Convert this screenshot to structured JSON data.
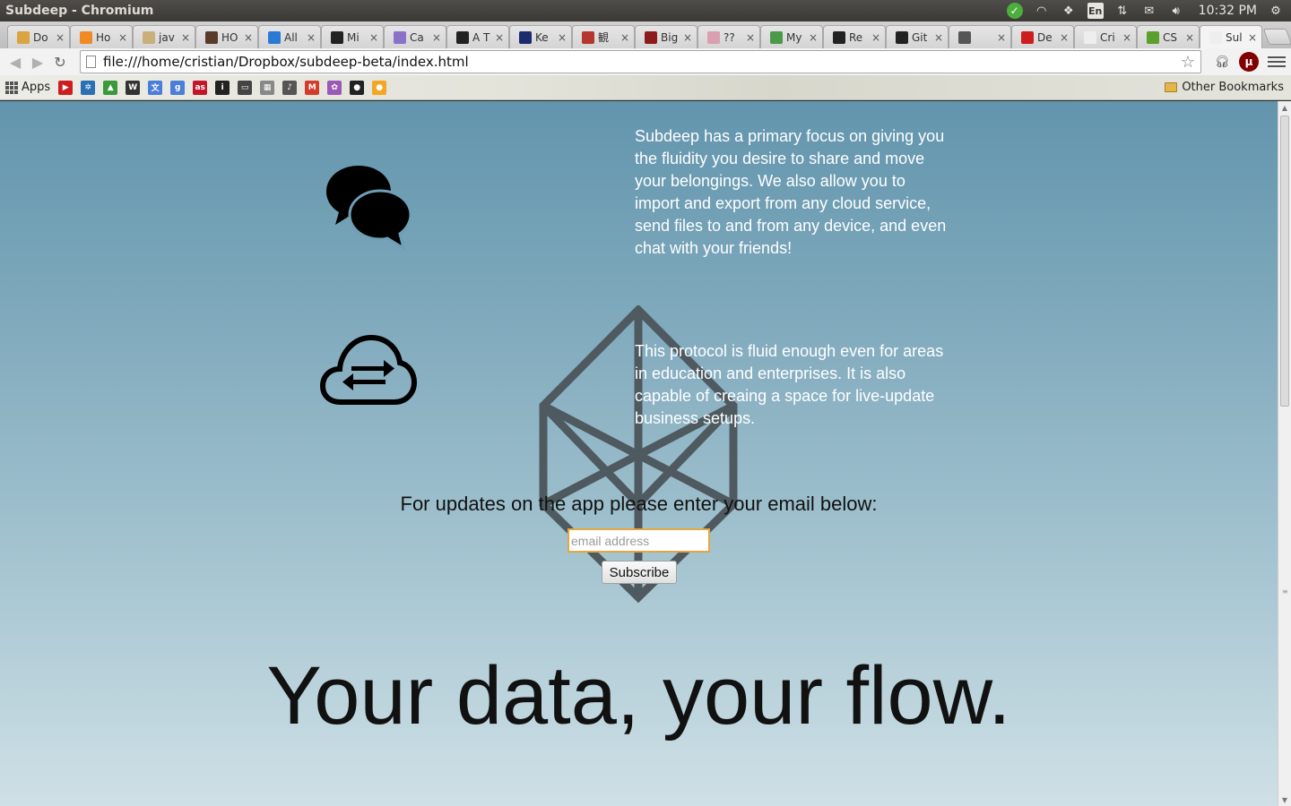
{
  "os": {
    "window_title": "Subdeep - Chromium",
    "keyboard": "En",
    "clock": "10:32 PM"
  },
  "tabs": [
    {
      "label": "Do",
      "favicon_color": "#d9a441",
      "icon": "generic-favicon"
    },
    {
      "label": "Ho",
      "favicon_color": "#f08a24",
      "icon": "asterisk-favicon"
    },
    {
      "label": "jav",
      "favicon_color": "#c9b07a",
      "icon": "generic-favicon"
    },
    {
      "label": "HO",
      "favicon_color": "#5a3a2a",
      "icon": "generic-favicon"
    },
    {
      "label": "All",
      "favicon_color": "#2a7ad5",
      "icon": "plus-favicon"
    },
    {
      "label": "Mi",
      "favicon_color": "#222222",
      "icon": "he-favicon"
    },
    {
      "label": "Ca",
      "favicon_color": "#8a72c9",
      "icon": "m-favicon"
    },
    {
      "label": "A T",
      "favicon_color": "#222222",
      "icon": "he-favicon"
    },
    {
      "label": "Ke",
      "favicon_color": "#1c2a6e",
      "icon": "film-favicon"
    },
    {
      "label": "観",
      "favicon_color": "#b5362d",
      "icon": "generic-favicon"
    },
    {
      "label": "Big",
      "favicon_color": "#8c1c1c",
      "icon": "generic-favicon"
    },
    {
      "label": "??",
      "favicon_color": "#d8a0b0",
      "icon": "generic-favicon"
    },
    {
      "label": "My",
      "favicon_color": "#4a9a4a",
      "icon": "drive-favicon"
    },
    {
      "label": "Re",
      "favicon_color": "#222222",
      "icon": "github-favicon"
    },
    {
      "label": "Git",
      "favicon_color": "#222222",
      "icon": "github-favicon"
    },
    {
      "label": "",
      "favicon_color": "#555555",
      "icon": "image-favicon"
    },
    {
      "label": "De",
      "favicon_color": "#cc1e1e",
      "icon": "youtube-favicon"
    },
    {
      "label": "Cri",
      "favicon_color": "#eeeeee",
      "icon": "page-favicon"
    },
    {
      "label": "CS",
      "favicon_color": "#5aa02c",
      "icon": "generic-favicon"
    },
    {
      "label": "Sul",
      "favicon_color": "#eeeeee",
      "icon": "page-favicon",
      "active": true
    }
  ],
  "toolbar": {
    "url": "file:///home/cristian/Dropbox/subdeep-beta/index.html"
  },
  "bookmarks": {
    "apps_label": "Apps",
    "items": [
      {
        "icon": "youtube-icon",
        "color": "#cc1e1e",
        "glyph": "▶"
      },
      {
        "icon": "network-icon",
        "color": "#2b6fb5",
        "glyph": "✲"
      },
      {
        "icon": "drive-icon",
        "color": "#3a9a3a",
        "glyph": "▲"
      },
      {
        "icon": "wikipedia-icon",
        "color": "#333333",
        "glyph": "W"
      },
      {
        "icon": "translate-icon",
        "color": "#4a7ed8",
        "glyph": "文"
      },
      {
        "icon": "google-icon",
        "color": "#4a7ed8",
        "glyph": "g"
      },
      {
        "icon": "lastfm-icon",
        "color": "#c4162a",
        "glyph": "as"
      },
      {
        "icon": "instapaper-icon",
        "color": "#222222",
        "glyph": "i"
      },
      {
        "icon": "terminal-icon",
        "color": "#444444",
        "glyph": "▭"
      },
      {
        "icon": "grid-icon",
        "color": "#888888",
        "glyph": "▦"
      },
      {
        "icon": "music-icon",
        "color": "#555555",
        "glyph": "♪"
      },
      {
        "icon": "gmail-icon",
        "color": "#d33b2c",
        "glyph": "M"
      },
      {
        "icon": "pinwheel-icon",
        "color": "#9b59b6",
        "glyph": "✿"
      },
      {
        "icon": "github-icon",
        "color": "#222222",
        "glyph": "●"
      },
      {
        "icon": "chat-bubble-icon",
        "color": "#f5a623",
        "glyph": "●"
      }
    ],
    "other_label": "Other Bookmarks"
  },
  "page": {
    "paragraph1": "Subdeep has a primary focus on giving you the fluidity you desire to share and move your belongings. We also allow you to import and export from any cloud service, send files to and from any device, and even chat with your friends!",
    "paragraph2": "This protocol is fluid enough even for areas in education and enterprises. It is also capable of creaing a space for live-update business setups.",
    "updates_prompt": "For updates on the app please enter your email below:",
    "email_placeholder": "email address",
    "email_value": "",
    "subscribe_label": "Subscribe",
    "tagline": "Your data, your flow."
  },
  "colors": {
    "page_gradient_top": "#6295ad",
    "page_gradient_bottom": "#cfe0e6",
    "logo_stroke": "#4f5a60",
    "input_focus": "#e5a542"
  }
}
